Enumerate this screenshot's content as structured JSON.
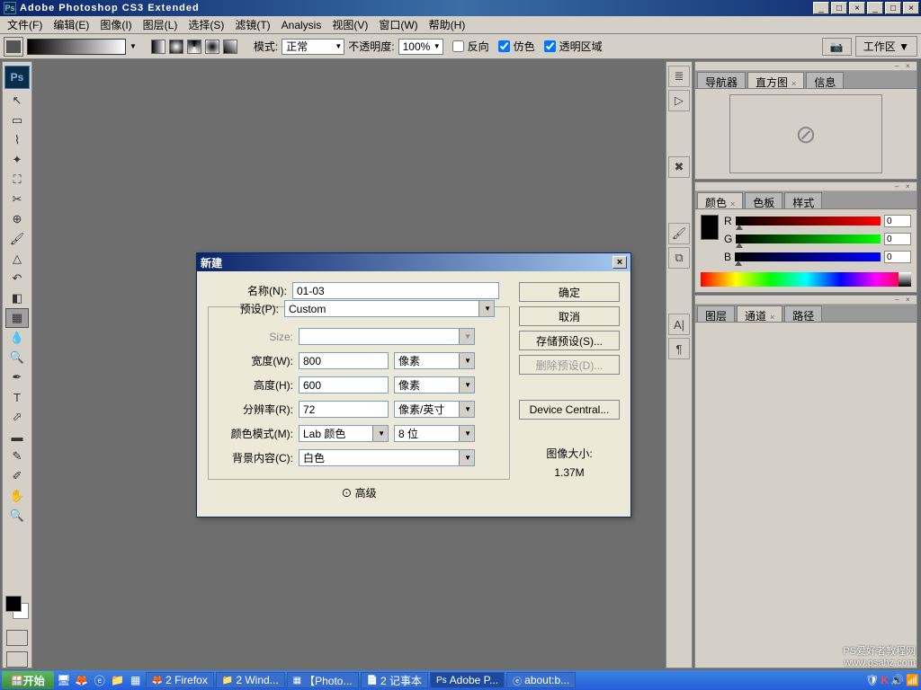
{
  "titlebar": {
    "title": "Adobe Photoshop CS3 Extended"
  },
  "menu": [
    "文件(F)",
    "编辑(E)",
    "图像(I)",
    "图层(L)",
    "选择(S)",
    "滤镜(T)",
    "Analysis",
    "视图(V)",
    "窗口(W)",
    "帮助(H)"
  ],
  "options": {
    "mode_label": "模式:",
    "mode_value": "正常",
    "opacity_label": "不透明度:",
    "opacity_value": "100%",
    "reverse": "反向",
    "dither": "仿色",
    "transp": "透明区域",
    "workspace": "工作区"
  },
  "dialog": {
    "title": "新建",
    "name_label": "名称(N):",
    "name_value": "01-03",
    "preset_label": "预设(P):",
    "preset_value": "Custom",
    "size_label": "Size:",
    "width_label": "宽度(W):",
    "width_value": "800",
    "width_unit": "像素",
    "height_label": "高度(H):",
    "height_value": "600",
    "height_unit": "像素",
    "resolution_label": "分辨率(R):",
    "resolution_value": "72",
    "resolution_unit": "像素/英寸",
    "colormode_label": "颜色模式(M):",
    "colormode_value": "Lab 颜色",
    "colormode_bits": "8 位",
    "bgcontent_label": "背景内容(C):",
    "bgcontent_value": "白色",
    "advanced": "高级",
    "ok": "确定",
    "cancel": "取消",
    "save_preset": "存储预设(S)...",
    "delete_preset": "删除预设(D)...",
    "device_central": "Device Central...",
    "imgsize_label": "图像大小:",
    "imgsize_value": "1.37M"
  },
  "panels": {
    "nav_tabs": [
      "导航器",
      "直方图",
      "信息"
    ],
    "color_tabs": [
      "颜色",
      "色板",
      "样式"
    ],
    "layer_tabs": [
      "图层",
      "通道",
      "路径"
    ],
    "rgb": {
      "r": "R",
      "g": "G",
      "b": "B",
      "rv": "0",
      "gv": "0",
      "bv": "0"
    }
  },
  "taskbar": {
    "start": "开始",
    "tasks": [
      "2 Firefox",
      "2 Wind...",
      "【Photo...",
      "2 记事本",
      "Adobe P...",
      "about:b..."
    ]
  },
  "watermark": "PS爱好者教程网\nwww.psahz.com"
}
